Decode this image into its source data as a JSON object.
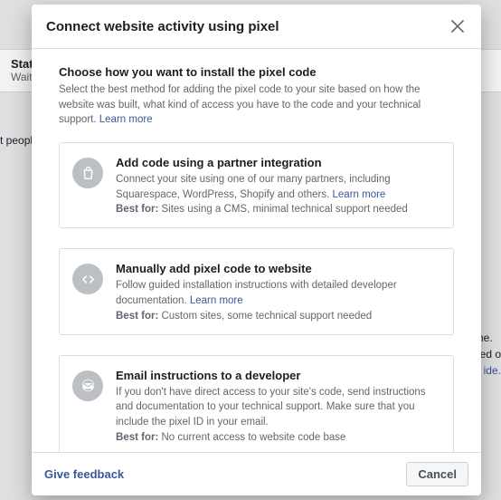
{
  "background": {
    "status_label": "Statu",
    "status_sub": "Waiti",
    "left_text": "t people t",
    "right_line1": "ame.",
    "right_line2": "ased o",
    "right_link": "ide."
  },
  "modal": {
    "title": "Connect website activity using pixel",
    "heading": "Choose how you want to install the pixel code",
    "description": "Select the best method for adding the pixel code to your site based on how the website was built, what kind of access you have to the code and your technical support.",
    "learn_more": "Learn more",
    "best_for_label": "Best for:",
    "options": [
      {
        "title": "Add code using a partner integration",
        "desc": "Connect your site using one of our many partners, including Squarespace, WordPress, Shopify and others.",
        "has_learn_more": true,
        "best_for": " Sites using a CMS, minimal technical support needed"
      },
      {
        "title": "Manually add pixel code to website",
        "desc": "Follow guided installation instructions with detailed developer documentation.",
        "has_learn_more": true,
        "best_for": " Custom sites, some technical support needed"
      },
      {
        "title": "Email instructions to a developer",
        "desc": "If you don't have direct access to your site's code, send instructions and documentation to your technical support. Make sure that you include the pixel ID in your email.",
        "has_learn_more": false,
        "best_for": " No current access to website code base"
      }
    ],
    "footer": {
      "feedback": "Give feedback",
      "cancel": "Cancel"
    }
  }
}
